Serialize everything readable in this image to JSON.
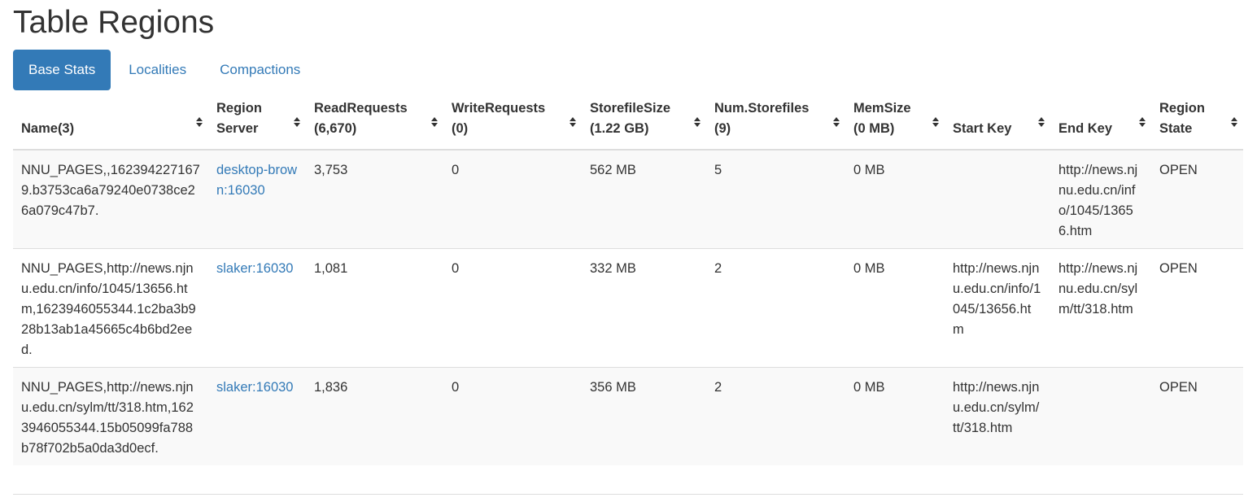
{
  "page": {
    "title": "Table Regions"
  },
  "tabs": [
    {
      "label": "Base Stats",
      "active": true
    },
    {
      "label": "Localities",
      "active": false
    },
    {
      "label": "Compactions",
      "active": false
    }
  ],
  "table": {
    "headers": [
      {
        "line1": "",
        "line2": "Name(3)"
      },
      {
        "line1": "Region",
        "line2": "Server"
      },
      {
        "line1": "ReadRequests",
        "line2": "(6,670)"
      },
      {
        "line1": "WriteRequests",
        "line2": "(0)"
      },
      {
        "line1": "StorefileSize",
        "line2": "(1.22 GB)"
      },
      {
        "line1": "Num.Storefiles",
        "line2": "(9)"
      },
      {
        "line1": "MemSize",
        "line2": "(0 MB)"
      },
      {
        "line1": "",
        "line2": "Start Key"
      },
      {
        "line1": "",
        "line2": "End Key"
      },
      {
        "line1": "Region",
        "line2": "State"
      }
    ],
    "rows": [
      {
        "name": "NNU_PAGES,,1623942271679.b3753ca6a79240e0738ce26a079c47b7.",
        "server": "desktop-brown:16030",
        "read": "3,753",
        "write": "0",
        "storefile_size": "562 MB",
        "num_storefiles": "5",
        "mem_size": "0 MB",
        "start_key": "",
        "end_key": "http://news.njnu.edu.cn/info/1045/13656.htm",
        "state": "OPEN"
      },
      {
        "name": "NNU_PAGES,http://news.njnu.edu.cn/info/1045/13656.htm,1623946055344.1c2ba3b928b13ab1a45665c4b6bd2eed.",
        "server": "slaker:16030",
        "read": "1,081",
        "write": "0",
        "storefile_size": "332 MB",
        "num_storefiles": "2",
        "mem_size": "0 MB",
        "start_key": "http://news.njnu.edu.cn/info/1045/13656.htm",
        "end_key": "http://news.njnu.edu.cn/sylm/tt/318.htm",
        "state": "OPEN"
      },
      {
        "name": "NNU_PAGES,http://news.njnu.edu.cn/sylm/tt/318.htm,1623946055344.15b05099fa788b78f702b5a0da3d0ecf.",
        "server": "slaker:16030",
        "read": "1,836",
        "write": "0",
        "storefile_size": "356 MB",
        "num_storefiles": "2",
        "mem_size": "0 MB",
        "start_key": "http://news.njnu.edu.cn/sylm/tt/318.htm",
        "end_key": "",
        "state": "OPEN"
      }
    ]
  },
  "icons": {
    "sort": "sort-both-icon"
  },
  "colors": {
    "accent": "#337ab7",
    "stripe": "#f9f9f9",
    "border": "#dddddd",
    "text": "#333333"
  }
}
